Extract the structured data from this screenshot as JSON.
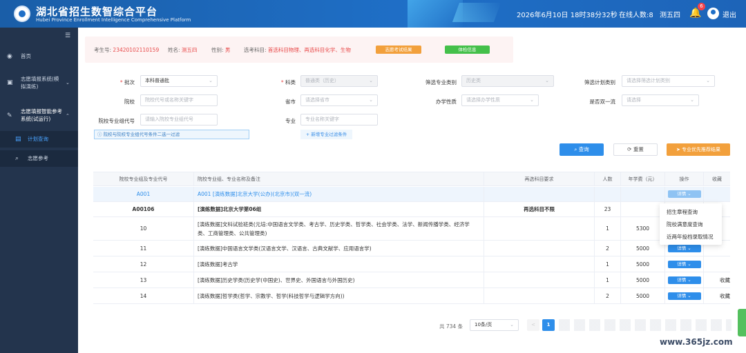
{
  "header": {
    "title": "湖北省招生数智综合平台",
    "subtitle": "Hubei Province Enrollment Intelligence Comprehensive Platform",
    "datetime": "2026年6月10日 18时38分32秒",
    "online": "在线人数:8",
    "user": "测五四",
    "notifications": "6",
    "logout": "退出"
  },
  "sidebar": {
    "items": [
      {
        "label": "首页"
      },
      {
        "label": "志愿填报系统(模拟演练)"
      },
      {
        "label": "志愿填报智能参考系统(试运行)"
      }
    ],
    "sub": [
      {
        "label": "计划查询"
      },
      {
        "label": "志愿参考"
      }
    ]
  },
  "student": {
    "id_label": "考生号:",
    "id": "23420102110159",
    "name_label": "姓名:",
    "name": "测五四",
    "gender_label": "性别:",
    "gender": "男",
    "subjects_label": "选考科目:",
    "subjects": "首选科目物理、再选科目化学、生物",
    "btn_exam": "志愿考试结果",
    "btn_physical": "体检信息"
  },
  "filters": {
    "batch_label": "批次",
    "batch": "本科普通批",
    "category_label": "科类",
    "category": "普通类（历史）",
    "major_type_label": "筛选专业类别",
    "major_type": "历史类",
    "plan_type_label": "筛选计划类别",
    "plan_type_ph": "请选择筛选计划类别",
    "school_label": "院校",
    "school_ph": "院校代号或名称关键字",
    "province_label": "省市",
    "province_ph": "请选择省市",
    "nature_label": "办学性质",
    "nature_ph": "请选择办学性质",
    "double_label": "是否双一流",
    "double_ph": "请选择",
    "group_label": "院校专业组代号",
    "group_ph": "请输入院校专业组代号",
    "major_label": "专业",
    "major_ph": "专业名称关键字",
    "hint": "院校与院校专业组代号条件二选一过滤",
    "add_filter": "+ 新增专业过滤条件",
    "query": "查询",
    "reset": "重置",
    "recommend": "专业优先推荐结果"
  },
  "table": {
    "headers": [
      "院校专业组及专业代号",
      "院校专业组、专业名称及备注",
      "再选科目要求",
      "人数",
      "年学费（元）",
      "操作",
      "收藏"
    ],
    "rows": [
      {
        "code": "A001",
        "name": "A001 [演练数据]北京大学(公办)(北京市)(双一流)",
        "req": "",
        "num": "",
        "fee": "",
        "op": "详情 ⌄",
        "fav": ""
      },
      {
        "code": "A00106",
        "name": "[演练数据]北京大学第06组",
        "req": "再选科目不限",
        "num": "23",
        "fee": "",
        "op": "",
        "fav": ""
      },
      {
        "code": "10",
        "name": "[演练数据]文科试验班类(元培:中国语言文学类、考古学、历史学类、哲学类、社会学类、法学、新闻传播学类、经济学类、工商管理类、公共管理类)",
        "req": "",
        "num": "1",
        "fee": "5300",
        "op": "",
        "fav": ""
      },
      {
        "code": "11",
        "name": "[演练数据]中国语言文学类(汉语言文学、汉语言、古典文献学、应用语言学)",
        "req": "",
        "num": "2",
        "fee": "5000",
        "op": "详情 ⌄",
        "fav": ""
      },
      {
        "code": "12",
        "name": "[演练数据]考古学",
        "req": "",
        "num": "1",
        "fee": "5000",
        "op": "详情 ⌄",
        "fav": ""
      },
      {
        "code": "13",
        "name": "[演练数据]历史学类(历史学(中国史)、世界史、外国语言与外国历史)",
        "req": "",
        "num": "1",
        "fee": "5000",
        "op": "详情 ⌄",
        "fav": "收藏"
      },
      {
        "code": "14",
        "name": "[演练数据]哲学类(哲学、宗教学、哲学(科技哲学与逻辑学方向))",
        "req": "",
        "num": "2",
        "fee": "5000",
        "op": "详情 ⌄",
        "fav": "收藏"
      }
    ]
  },
  "dropdown": [
    "招生章程查询",
    "院校满意度查询",
    "近两年投档录取情况"
  ],
  "pager": {
    "total": "共 734 条",
    "size": "10条/页",
    "prev": "<",
    "current": "1"
  },
  "watermark": "www.365jz.com",
  "colors": {
    "header": "#1f6fc7",
    "sidebar": "#23344d",
    "primary": "#2e8eea",
    "orange": "#f2a03c",
    "green": "#44c04a",
    "red": "#e84a4a"
  }
}
